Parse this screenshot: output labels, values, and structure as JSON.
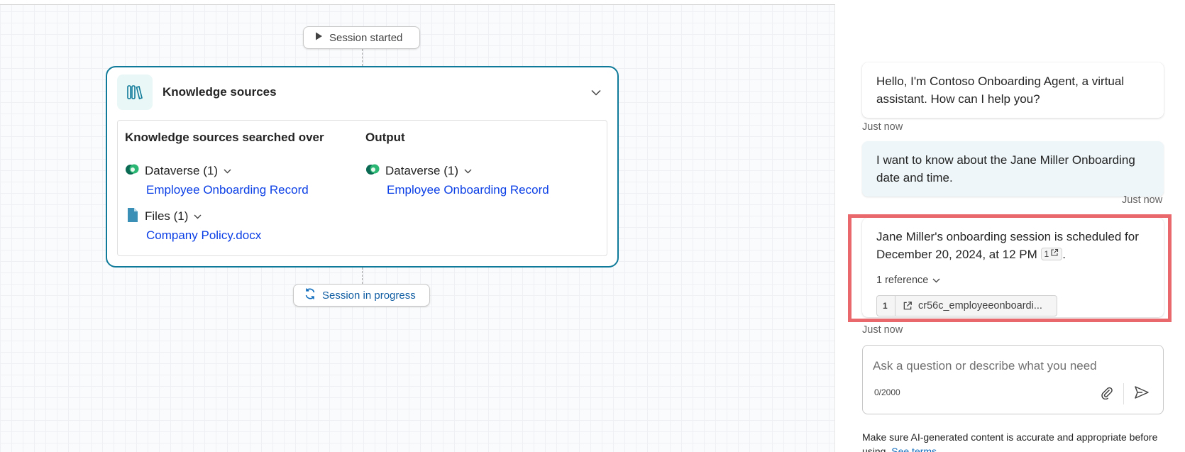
{
  "canvas": {
    "session_started_label": "Session started",
    "session_in_progress_label": "Session in progress",
    "knowledge_card": {
      "title": "Knowledge sources",
      "searched_heading": "Knowledge sources searched over",
      "output_heading": "Output",
      "searched": [
        {
          "icon": "dataverse-icon",
          "label": "Dataverse (1)",
          "link": "Employee Onboarding Record"
        },
        {
          "icon": "file-icon",
          "label": "Files (1)",
          "link": "Company Policy.docx"
        }
      ],
      "output": [
        {
          "icon": "dataverse-icon",
          "label": "Dataverse (1)",
          "link": "Employee Onboarding Record"
        }
      ]
    }
  },
  "chat": {
    "messages": [
      {
        "role": "bot",
        "text": "Hello, I'm Contoso Onboarding Agent, a virtual assistant. How can I help you?",
        "timestamp": "Just now"
      },
      {
        "role": "user",
        "text": "I want to know about the Jane Miller Onboarding date and time.",
        "timestamp": "Just now"
      },
      {
        "role": "bot",
        "text": "Jane Miller's onboarding session is scheduled for December 20, 2024, at 12 PM",
        "citation": "1",
        "trailing": ".",
        "references_toggle": "1 reference",
        "reference": {
          "number": "1",
          "name": "cr56c_employeeonboardi..."
        },
        "timestamp": "Just now"
      }
    ],
    "composer": {
      "placeholder": "Ask a question or describe what you need",
      "value": "",
      "counter": "0/2000"
    },
    "disclaimer": {
      "text": "Make sure AI-generated content is accurate and appropriate before using.",
      "link": "See terms"
    }
  },
  "colors": {
    "card_border": "#0f7a99",
    "link": "#0b3fe6",
    "highlight": "#e8686b",
    "user_bubble": "#eef6f9"
  }
}
